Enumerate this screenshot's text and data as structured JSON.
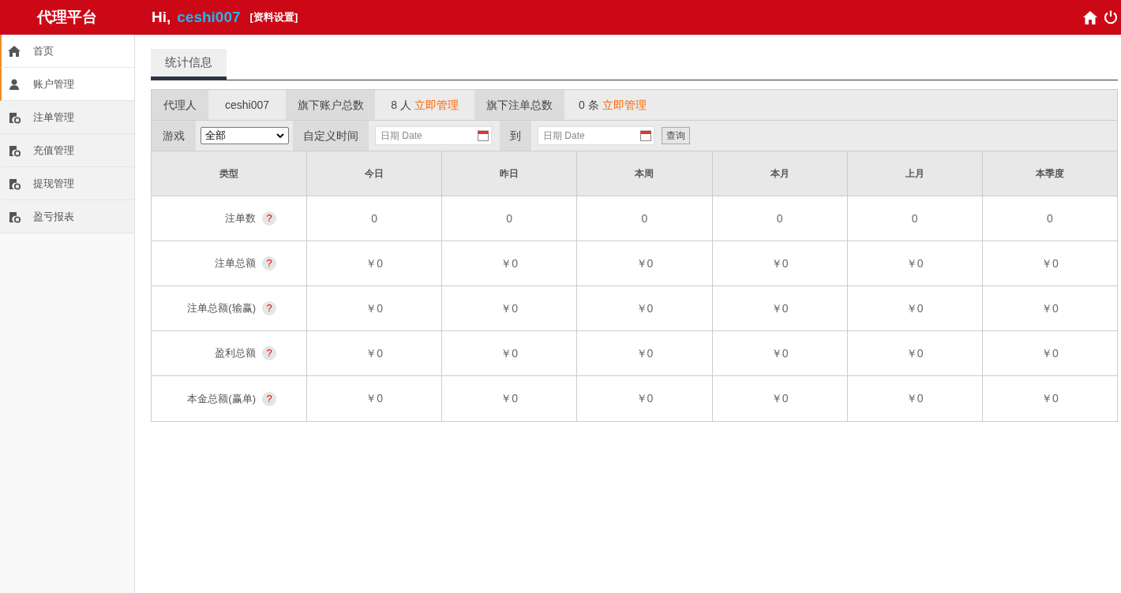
{
  "header": {
    "brand": "代理平台",
    "greeting": "Hi,",
    "username": "ceshi007",
    "profile_link": "[资料设置]"
  },
  "sidebar": {
    "items": [
      {
        "label": "首页",
        "kind": "home",
        "selected": true
      },
      {
        "label": "账户管理",
        "kind": "user",
        "selected": true
      },
      {
        "label": "注单管理",
        "kind": "doc",
        "selected": false
      },
      {
        "label": "充值管理",
        "kind": "doc",
        "selected": false
      },
      {
        "label": "提现管理",
        "kind": "doc",
        "selected": false
      },
      {
        "label": "盈亏报表",
        "kind": "doc",
        "selected": false
      }
    ]
  },
  "tabs": [
    {
      "label": "统计信息",
      "selected": true
    }
  ],
  "summary": {
    "agent_label": "代理人",
    "agent": "ceshi007",
    "accounts_label": "旗下账户总数",
    "accounts_count": "8 人",
    "accounts_link": "立即管理",
    "orders_label": "旗下注单总数",
    "orders_count": "0 条",
    "orders_link": "立即管理"
  },
  "filters": {
    "game_label": "游戏",
    "game_value": "全部",
    "time_label": "自定义时间",
    "from_placeholder": "日期 Date",
    "to_label": "到",
    "to_placeholder": "日期 Date",
    "query_button": "查询"
  },
  "table": {
    "columns": [
      "类型",
      "今日",
      "昨日",
      "本周",
      "本月",
      "上月",
      "本季度"
    ],
    "rows": [
      {
        "label": "注单数",
        "help": "?",
        "values": [
          "0",
          "0",
          "0",
          "0",
          "0",
          "0"
        ]
      },
      {
        "label": "注单总额",
        "help": "?",
        "values": [
          "￥0",
          "￥0",
          "￥0",
          "￥0",
          "￥0",
          "￥0"
        ]
      },
      {
        "label": "注单总额(输赢)",
        "help": "?",
        "values": [
          "￥0",
          "￥0",
          "￥0",
          "￥0",
          "￥0",
          "￥0"
        ]
      },
      {
        "label": "盈利总额",
        "help": "?",
        "values": [
          "￥0",
          "￥0",
          "￥0",
          "￥0",
          "￥0",
          "￥0"
        ]
      },
      {
        "label": "本金总额(赢单)",
        "help": "?",
        "values": [
          "￥0",
          "￥0",
          "￥0",
          "￥0",
          "￥0",
          "￥0"
        ]
      }
    ]
  }
}
